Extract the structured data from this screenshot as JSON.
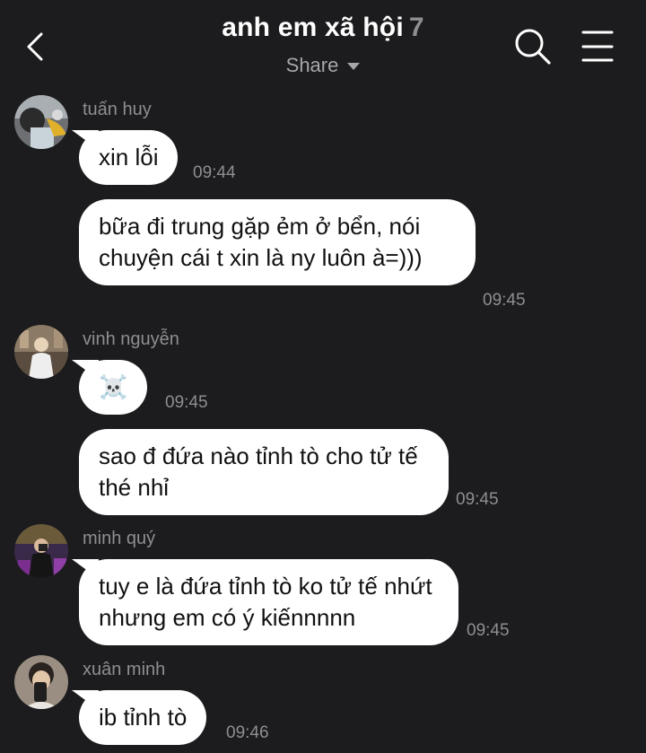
{
  "header": {
    "title": "anh em xã hội",
    "member_count": "7",
    "subtitle": "Share",
    "icons": {
      "back": "chevron-left-icon",
      "search": "search-icon",
      "menu": "hamburger-menu-icon",
      "dropdown": "caret-down-icon"
    }
  },
  "messages": [
    {
      "sender": "tuấn huy",
      "text": "xin lỗi",
      "time": "09:44"
    },
    {
      "text": "bữa đi trung gặp ẻm ở bển, nói chuyện cái t xin là ny luôn à=)))",
      "time": "09:45"
    },
    {
      "sender": "vinh nguyễn",
      "text": "☠️",
      "time": "09:45"
    },
    {
      "text": "sao đ đứa nào tỉnh tò cho tử tế thé nhỉ",
      "time": "09:45"
    },
    {
      "sender": "minh quý",
      "text": "tuy e là đứa tỉnh tò ko tử tế nhứt nhưng em có ý kiếnnnnn",
      "time": "09:45"
    },
    {
      "sender": "xuân minh",
      "text": "ib tỉnh tò",
      "time": "09:46"
    }
  ],
  "colors": {
    "background": "#1c1c1e",
    "bubble": "#ffffff",
    "muted_text": "#8e8e93"
  }
}
